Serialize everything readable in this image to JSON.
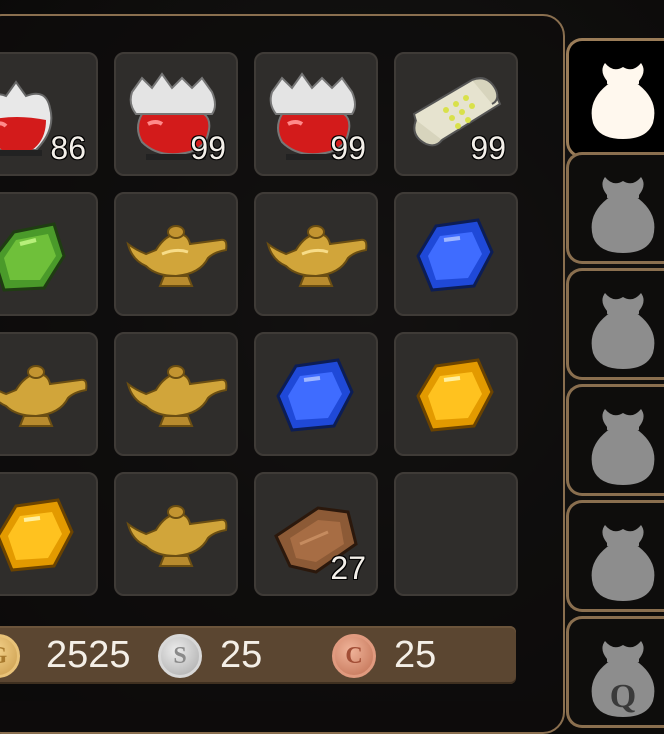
{
  "inventory": {
    "rows": [
      [
        {
          "item": "health-potion",
          "icon": "red-potion-icon",
          "qty": "86"
        },
        {
          "item": "health-potion",
          "icon": "red-potion-icon",
          "qty": "99"
        },
        {
          "item": "health-potion",
          "icon": "red-potion-icon",
          "qty": "99"
        },
        {
          "item": "scroll",
          "icon": "scroll-icon",
          "qty": "99"
        }
      ],
      [
        {
          "item": "emerald",
          "icon": "green-gem-icon",
          "qty": ""
        },
        {
          "item": "magic-lamp",
          "icon": "golden-lamp-icon",
          "qty": ""
        },
        {
          "item": "magic-lamp",
          "icon": "golden-lamp-icon",
          "qty": ""
        },
        {
          "item": "sapphire",
          "icon": "blue-gem-icon",
          "qty": ""
        }
      ],
      [
        {
          "item": "magic-lamp",
          "icon": "golden-lamp-icon",
          "qty": ""
        },
        {
          "item": "magic-lamp",
          "icon": "golden-lamp-icon",
          "qty": ""
        },
        {
          "item": "sapphire",
          "icon": "blue-gem-icon",
          "qty": ""
        },
        {
          "item": "topaz",
          "icon": "yellow-gem-icon",
          "qty": ""
        }
      ],
      [
        {
          "item": "topaz",
          "icon": "yellow-gem-icon",
          "qty": ""
        },
        {
          "item": "magic-lamp",
          "icon": "golden-lamp-icon",
          "qty": ""
        },
        {
          "item": "leather-hide",
          "icon": "leather-icon",
          "qty": "27"
        },
        {
          "item": "empty",
          "icon": "",
          "qty": ""
        }
      ]
    ]
  },
  "currency": {
    "gold": {
      "symbol": "G",
      "amount": "2525"
    },
    "silver": {
      "symbol": "S",
      "amount": "25"
    },
    "copper": {
      "symbol": "C",
      "amount": "25"
    }
  },
  "tabs": [
    {
      "name": "bag-1",
      "icon": "bag-icon",
      "active": true
    },
    {
      "name": "bag-2",
      "icon": "bag-icon",
      "active": false
    },
    {
      "name": "bag-3",
      "icon": "bag-icon",
      "active": false
    },
    {
      "name": "bag-4",
      "icon": "bag-icon",
      "active": false
    },
    {
      "name": "bag-5",
      "icon": "bag-icon",
      "active": false
    },
    {
      "name": "quest-bag",
      "icon": "quest-bag-icon",
      "label": "Q",
      "active": false
    }
  ],
  "colors": {
    "panel_border": "#8a6f4f",
    "slot_bg": "#2f2d2b",
    "currency_bar": "#5b4631"
  }
}
